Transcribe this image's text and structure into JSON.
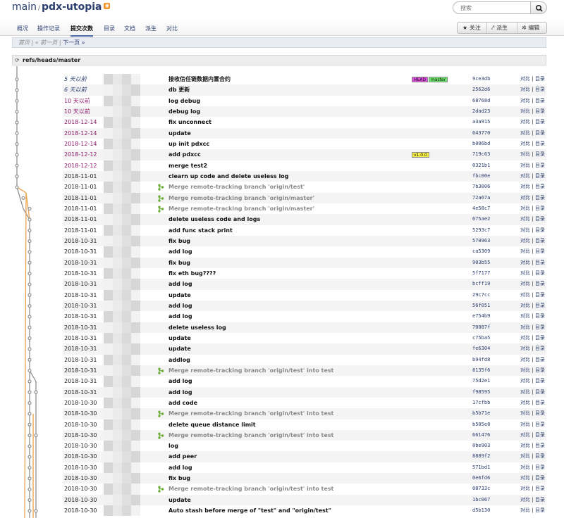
{
  "header": {
    "owner": "main",
    "separator": "/",
    "repo": "pdx-utopia",
    "search_placeholder": "搜索"
  },
  "nav": {
    "tabs": [
      {
        "label": "概况",
        "active": false
      },
      {
        "label": "操作记录",
        "active": false
      },
      {
        "label": "提交次数",
        "active": true
      },
      {
        "label": "目录",
        "active": false
      },
      {
        "label": "文档",
        "active": false
      },
      {
        "label": "派生",
        "active": false
      },
      {
        "label": "对比",
        "active": false
      }
    ],
    "actions": {
      "watch_label": "关注",
      "fork_label": "派生",
      "edit_label": "编辑"
    }
  },
  "pager": {
    "first_label": "首页",
    "prev_label": "« 前一页",
    "next_label": "下一页 »",
    "divider": "|"
  },
  "branch": {
    "ref": "refs/heads/master"
  },
  "colors": {
    "head_badge": "#e44ee0",
    "master_badge": "#6ee86e",
    "tag_badge": "#f7ef45",
    "graph_gray": "#8f8f8f",
    "graph_orange": "#e8a24c",
    "merge_icon": "#6fae3a"
  },
  "commits": [
    {
      "date": "5 天以前",
      "subject": "接收信任链数据内置合约",
      "hash": "9ce3db",
      "refs": [
        {
          "label": "HEAD",
          "type": "head"
        },
        {
          "label": "master",
          "type": "branch"
        }
      ],
      "merge": false
    },
    {
      "date": "6 天以前",
      "subject": "db 更新",
      "hash": "2562d6",
      "refs": [],
      "merge": false
    },
    {
      "date": "10 天以前",
      "subject": "log debug",
      "hash": "68768d",
      "refs": [],
      "merge": false
    },
    {
      "date": "10 天以前",
      "subject": "debug log",
      "hash": "2dad23",
      "refs": [],
      "merge": false
    },
    {
      "date": "2018-12-14",
      "subject": "fix unconnect",
      "hash": "a3a915",
      "refs": [],
      "merge": false
    },
    {
      "date": "2018-12-14",
      "subject": "update",
      "hash": "643770",
      "refs": [],
      "merge": false
    },
    {
      "date": "2018-12-14",
      "subject": "up init pdxcc",
      "hash": "b006bd",
      "refs": [],
      "merge": false
    },
    {
      "date": "2018-12-12",
      "subject": "add pdxcc",
      "hash": "719c63",
      "refs": [
        {
          "label": "v1.0.0",
          "type": "tag"
        }
      ],
      "merge": false
    },
    {
      "date": "2018-12-12",
      "subject": "merge test2",
      "hash": "0321b1",
      "refs": [],
      "merge": false
    },
    {
      "date": "2018-11-01",
      "subject": "clearn up code and delete useless log",
      "hash": "fbc00e",
      "refs": [],
      "merge": false
    },
    {
      "date": "2018-11-01",
      "subject": "Merge remote-tracking branch 'origin/test'",
      "hash": "7b3006",
      "refs": [],
      "merge": true
    },
    {
      "date": "2018-11-01",
      "subject": "Merge remote-tracking branch 'origin/master'",
      "hash": "72a67a",
      "refs": [],
      "merge": true
    },
    {
      "date": "2018-11-01",
      "subject": "Merge remote-tracking branch 'origin/master'",
      "hash": "4e58c7",
      "refs": [],
      "merge": true
    },
    {
      "date": "2018-11-01",
      "subject": "delete useless code and logs",
      "hash": "675ae2",
      "refs": [],
      "merge": false
    },
    {
      "date": "2018-11-01",
      "subject": "add func stack print",
      "hash": "5293c7",
      "refs": [],
      "merge": false
    },
    {
      "date": "2018-10-31",
      "subject": "fix bug",
      "hash": "570963",
      "refs": [],
      "merge": false
    },
    {
      "date": "2018-10-31",
      "subject": "add log",
      "hash": "ca5309",
      "refs": [],
      "merge": false
    },
    {
      "date": "2018-10-31",
      "subject": "fix bug",
      "hash": "903b55",
      "refs": [],
      "merge": false
    },
    {
      "date": "2018-10-31",
      "subject": "fix eth bug????",
      "hash": "5f7177",
      "refs": [],
      "merge": false
    },
    {
      "date": "2018-10-31",
      "subject": "add log",
      "hash": "bcff19",
      "refs": [],
      "merge": false
    },
    {
      "date": "2018-10-31",
      "subject": "update",
      "hash": "29c7cc",
      "refs": [],
      "merge": false
    },
    {
      "date": "2018-10-31",
      "subject": "add log",
      "hash": "56f051",
      "refs": [],
      "merge": false
    },
    {
      "date": "2018-10-31",
      "subject": "add log",
      "hash": "e754b9",
      "refs": [],
      "merge": false
    },
    {
      "date": "2018-10-31",
      "subject": "delete useless log",
      "hash": "70087f",
      "refs": [],
      "merge": false
    },
    {
      "date": "2018-10-31",
      "subject": "update",
      "hash": "c75ba5",
      "refs": [],
      "merge": false
    },
    {
      "date": "2018-10-31",
      "subject": "update",
      "hash": "fe6304",
      "refs": [],
      "merge": false
    },
    {
      "date": "2018-10-31",
      "subject": "addlog",
      "hash": "b94fd8",
      "refs": [],
      "merge": false
    },
    {
      "date": "2018-10-31",
      "subject": "Merge remote-tracking branch 'origin/test' into test",
      "hash": "8135f6",
      "refs": [],
      "merge": true
    },
    {
      "date": "2018-10-31",
      "subject": "add log",
      "hash": "75d2e1",
      "refs": [],
      "merge": false
    },
    {
      "date": "2018-10-31",
      "subject": "add log",
      "hash": "f98595",
      "refs": [],
      "merge": false
    },
    {
      "date": "2018-10-30",
      "subject": "add code",
      "hash": "17cfbb",
      "refs": [],
      "merge": false
    },
    {
      "date": "2018-10-30",
      "subject": "Merge remote-tracking branch 'origin/test' into test",
      "hash": "b5b71e",
      "refs": [],
      "merge": true
    },
    {
      "date": "2018-10-30",
      "subject": "delete queue distance limit",
      "hash": "b505e8",
      "refs": [],
      "merge": false
    },
    {
      "date": "2018-10-30",
      "subject": "Merge remote-tracking branch 'origin/test' into test",
      "hash": "661476",
      "refs": [],
      "merge": true
    },
    {
      "date": "2018-10-30",
      "subject": "log",
      "hash": "0be903",
      "refs": [],
      "merge": false
    },
    {
      "date": "2018-10-30",
      "subject": "add peer",
      "hash": "8889f2",
      "refs": [],
      "merge": false
    },
    {
      "date": "2018-10-30",
      "subject": "add log",
      "hash": "571bd1",
      "refs": [],
      "merge": false
    },
    {
      "date": "2018-10-30",
      "subject": "fix bug",
      "hash": "0e6fd6",
      "refs": [],
      "merge": false
    },
    {
      "date": "2018-10-30",
      "subject": "Merge remote-tracking branch 'origin/test' into test",
      "hash": "08733c",
      "refs": [],
      "merge": true
    },
    {
      "date": "2018-10-30",
      "subject": "update",
      "hash": "1bc067",
      "refs": [],
      "merge": false
    },
    {
      "date": "2018-10-30",
      "subject": "Auto stash before merge of \"test\" and \"origin/test\"",
      "hash": "d5b130",
      "refs": [],
      "merge": false
    }
  ],
  "row_links": {
    "compare": "对比",
    "divider": "|",
    "tree": "目录"
  }
}
